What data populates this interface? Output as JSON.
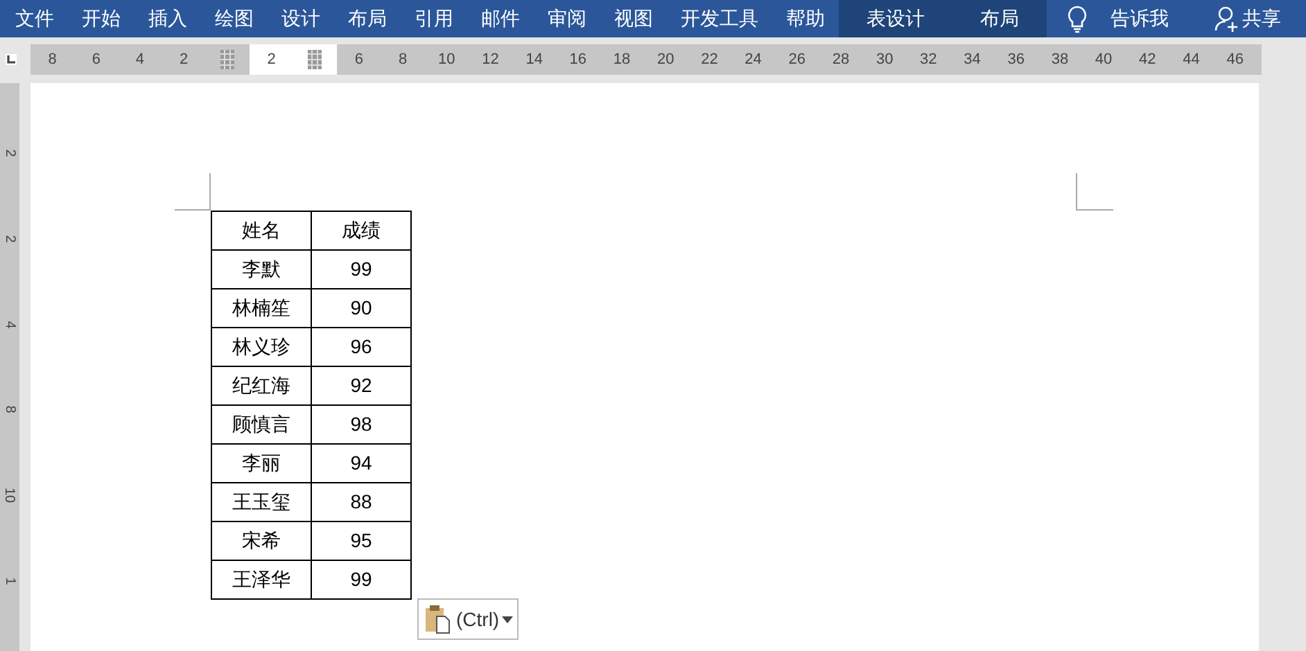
{
  "ribbon_tabs": [
    {
      "label": "文件",
      "contextual": false
    },
    {
      "label": "开始",
      "contextual": false
    },
    {
      "label": "插入",
      "contextual": false
    },
    {
      "label": "绘图",
      "contextual": false
    },
    {
      "label": "设计",
      "contextual": false
    },
    {
      "label": "布局",
      "contextual": false
    },
    {
      "label": "引用",
      "contextual": false
    },
    {
      "label": "邮件",
      "contextual": false
    },
    {
      "label": "审阅",
      "contextual": false
    },
    {
      "label": "视图",
      "contextual": false
    },
    {
      "label": "开发工具",
      "contextual": false
    },
    {
      "label": "帮助",
      "contextual": false
    },
    {
      "label": "表设计",
      "contextual": true
    },
    {
      "label": "布局",
      "contextual": true
    }
  ],
  "tell_me": "告诉我",
  "share": "共享",
  "ruler": [
    {
      "kind": "number",
      "label": "8"
    },
    {
      "kind": "number",
      "label": "6"
    },
    {
      "kind": "number",
      "label": "4"
    },
    {
      "kind": "number",
      "label": "2"
    },
    {
      "kind": "marker"
    },
    {
      "kind": "number",
      "label": "2"
    },
    {
      "kind": "marker"
    },
    {
      "kind": "number",
      "label": "6"
    },
    {
      "kind": "number",
      "label": "8"
    },
    {
      "kind": "number",
      "label": "10"
    },
    {
      "kind": "number",
      "label": "12"
    },
    {
      "kind": "number",
      "label": "14"
    },
    {
      "kind": "number",
      "label": "16"
    },
    {
      "kind": "number",
      "label": "18"
    },
    {
      "kind": "number",
      "label": "20"
    },
    {
      "kind": "number",
      "label": "22"
    },
    {
      "kind": "number",
      "label": "24"
    },
    {
      "kind": "number",
      "label": "26"
    },
    {
      "kind": "number",
      "label": "28"
    },
    {
      "kind": "number",
      "label": "30"
    },
    {
      "kind": "number",
      "label": "32"
    },
    {
      "kind": "number",
      "label": "34"
    },
    {
      "kind": "number",
      "label": "36"
    },
    {
      "kind": "number",
      "label": "38"
    },
    {
      "kind": "number",
      "label": "40"
    },
    {
      "kind": "number",
      "label": "42"
    },
    {
      "kind": "number",
      "label": "44"
    },
    {
      "kind": "number",
      "label": "46"
    }
  ],
  "vertical_ruler": [
    "2",
    "2",
    "4",
    "8",
    "10",
    "1"
  ],
  "table": {
    "columns": [
      "姓名",
      "成绩"
    ],
    "rows": [
      [
        "李默",
        "99"
      ],
      [
        "林楠笙",
        "90"
      ],
      [
        "林义珍",
        "96"
      ],
      [
        "纪红海",
        "92"
      ],
      [
        "顾慎言",
        "98"
      ],
      [
        "李丽",
        "94"
      ],
      [
        "王玉玺",
        "88"
      ],
      [
        "宋希",
        "95"
      ],
      [
        "王泽华",
        "99"
      ]
    ]
  },
  "paste_options": "(Ctrl)"
}
